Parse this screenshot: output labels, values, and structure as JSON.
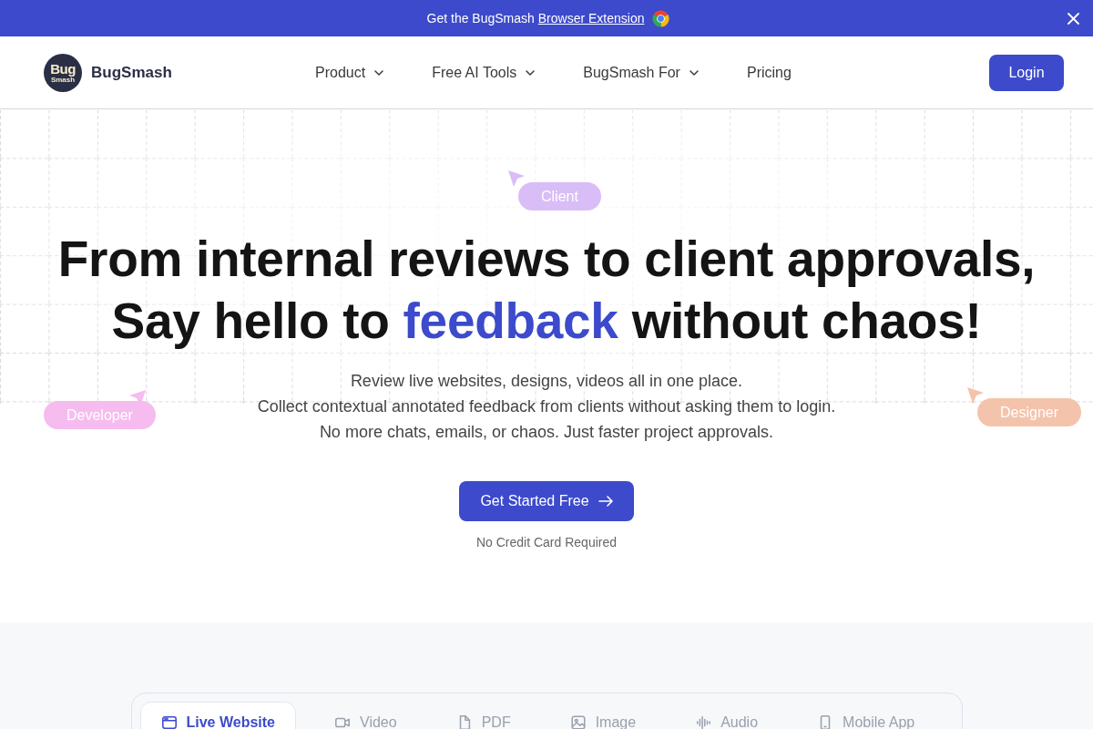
{
  "announcement": {
    "text": "Get the BugSmash",
    "link": "Browser Extension"
  },
  "header": {
    "logo": {
      "mark_lines": [
        "Bug",
        "Smash"
      ],
      "name": "BugSmash"
    },
    "nav": [
      {
        "label": "Product",
        "has_menu": true
      },
      {
        "label": "Free AI Tools",
        "has_menu": true
      },
      {
        "label": "BugSmash For",
        "has_menu": true
      },
      {
        "label": "Pricing",
        "has_menu": false
      }
    ],
    "login": "Login"
  },
  "hero": {
    "cursor_tags": [
      {
        "label": "Client",
        "color": "#d9bdf6"
      },
      {
        "label": "Developer",
        "color": "#f6bcef"
      },
      {
        "label": "Designer",
        "color": "#f4c3ab"
      }
    ],
    "headline": {
      "line_1": "From internal reviews to client approvals,",
      "line_2": [
        {
          "text": "Say hello to",
          "highlighted": false
        },
        {
          "text": "feedback",
          "highlighted": true
        },
        {
          "text": "without chaos!",
          "highlighted": false
        }
      ]
    },
    "description": [
      "Review live websites, designs, videos all in one place.",
      "Collect contextual annotated feedback from clients without asking them to login.",
      "No more chats, emails, or chaos. Just faster project approvals."
    ],
    "cta": "Get Started Free",
    "note": "No Credit Card Required"
  },
  "media_tabs": [
    {
      "label": "Live Website",
      "kind": "website",
      "selected": true
    },
    {
      "label": "Video",
      "kind": "video",
      "selected": false
    },
    {
      "label": "PDF",
      "kind": "pdf",
      "selected": false
    },
    {
      "label": "Image",
      "kind": "image",
      "selected": false
    },
    {
      "label": "Audio",
      "kind": "audio",
      "selected": false
    },
    {
      "label": "Mobile App",
      "kind": "mobile",
      "selected": false
    }
  ]
}
